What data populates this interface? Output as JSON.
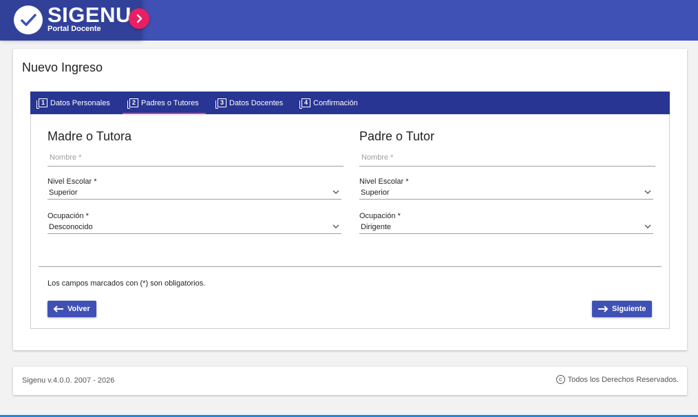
{
  "app": {
    "name": "SIGENU",
    "subtitle": "Portal Docente"
  },
  "page": {
    "title": "Nuevo Ingreso"
  },
  "tabs": [
    {
      "num": "1",
      "label": "Datos Personales"
    },
    {
      "num": "2",
      "label": "Padres o Tutores"
    },
    {
      "num": "3",
      "label": "Datos Docentes"
    },
    {
      "num": "4",
      "label": "Confirmación"
    }
  ],
  "mother": {
    "title": "Madre o Tutora",
    "name_placeholder": "Nombre *",
    "nivel_label": "Nivel Escolar *",
    "nivel_value": "Superior",
    "ocupacion_label": "Ocupación *",
    "ocupacion_value": "Desconocido"
  },
  "father": {
    "title": "Padre o Tutor",
    "name_placeholder": "Nombre *",
    "nivel_label": "Nivel Escolar *",
    "nivel_value": "Superior",
    "ocupacion_label": "Ocupación *",
    "ocupacion_value": "Dirigente"
  },
  "form": {
    "required_note": "Los campos marcados con (*) son obligatorios.",
    "back_label": "Volver",
    "next_label": "Siguiente"
  },
  "footer": {
    "version": "Sigenu v.4.0.0. 2007 - 2026",
    "rights": "Todos los Derechos Reservados."
  },
  "colors": {
    "primary": "#3f51b5",
    "tabbar": "#283593",
    "accent": "#e91e63"
  },
  "icons": {
    "logo": "check-circle-icon",
    "toggle": "chevron-right-icon",
    "tab": "filter-number-icon",
    "select": "chevron-down-icon",
    "back": "arrow-left-icon",
    "next": "arrow-right-icon",
    "copyright": "copyright-icon"
  }
}
